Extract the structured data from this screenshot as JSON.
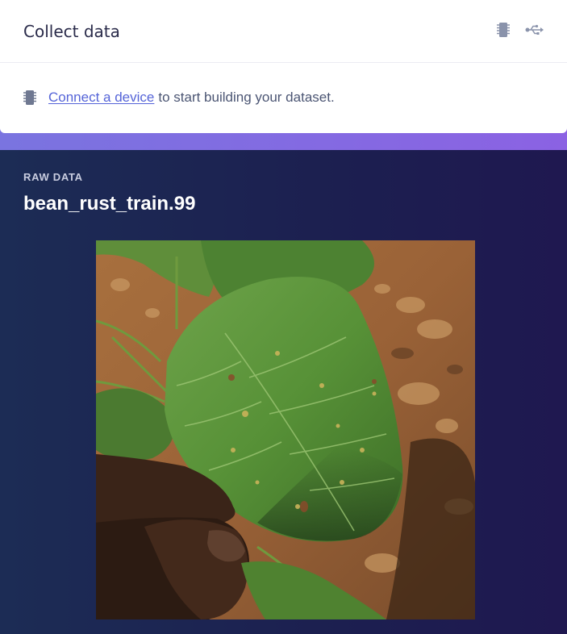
{
  "header": {
    "title": "Collect data",
    "icons": [
      "device-chip-icon",
      "usb-icon"
    ]
  },
  "connect": {
    "link_text": "Connect a device",
    "rest_text": "to start building your dataset."
  },
  "raw_data": {
    "label": "RAW DATA",
    "sample_name": "bean_rust_train.99"
  },
  "colors": {
    "accent": "#7a74e0",
    "panel": "#1c2c55",
    "link": "#5564d8"
  }
}
